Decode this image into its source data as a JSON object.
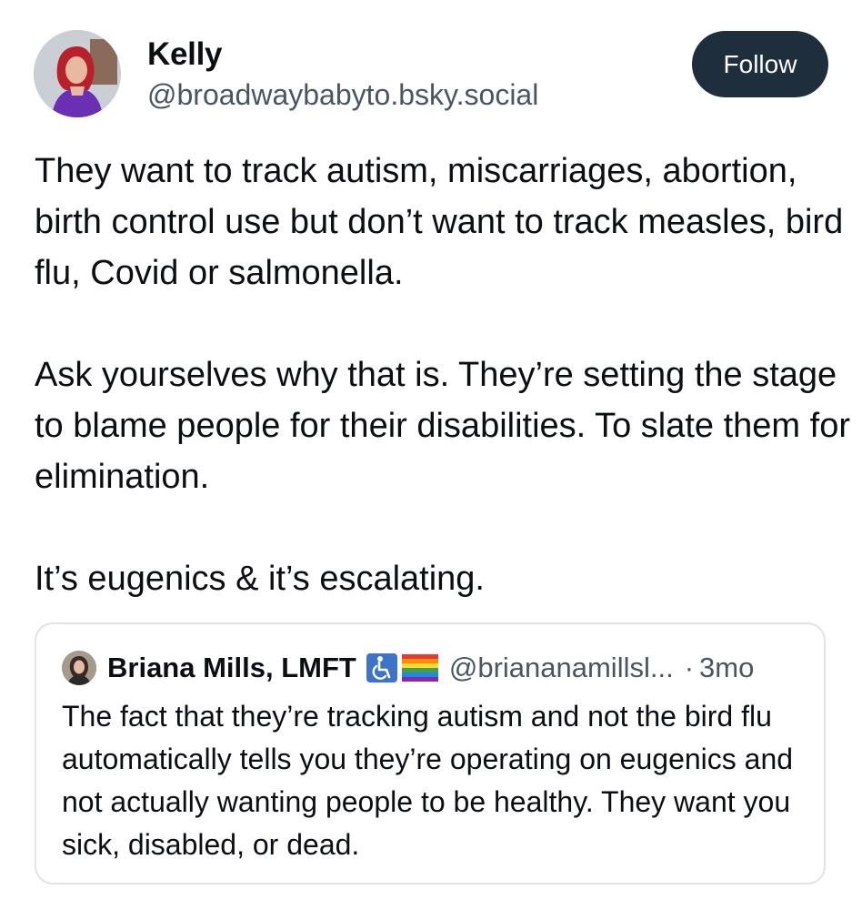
{
  "post": {
    "author_name": "Kelly",
    "author_handle": "@broadwaybabyto.bsky.social",
    "follow_label": "Follow",
    "avatar_icon": "profile-photo-avatar",
    "paragraphs": [
      "They want to track autism, miscarriages, abortion, birth control use but don’t want to track measles, bird flu, Covid or salmonella.",
      "Ask yourselves why that is. They’re setting the stage to blame people for their disabilities. To slate them for elimination.",
      "It’s eugenics & it’s escalating."
    ]
  },
  "quoted_post": {
    "author_name": "Briana Mills, LMFT",
    "badges": [
      "accessibility-icon",
      "rainbow-flag-icon"
    ],
    "author_handle": "@briananamillsl...",
    "separator": "·",
    "timestamp": "3mo",
    "text": "The fact that they’re tracking autism and not the bird flu automatically tells you they’re operating on eugenics and not actually wanting people to be healthy. They want you sick, disabled, or dead."
  },
  "colors": {
    "follow_button_bg": "#1f2e3d",
    "secondary_text": "#4a5560",
    "border": "#dfe3e8"
  }
}
